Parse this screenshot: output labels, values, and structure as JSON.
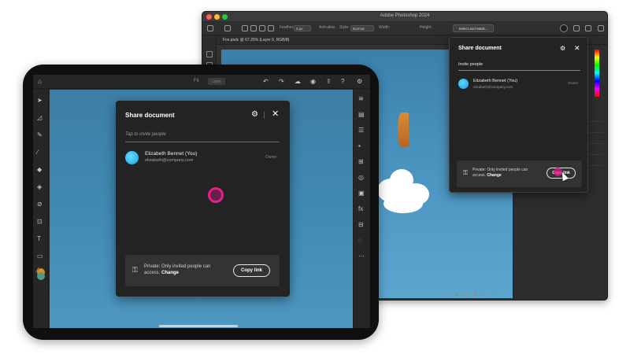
{
  "desktop": {
    "window_title": "Adobe Photoshop 2024",
    "options_bar": {
      "feather_label": "Feather:",
      "feather_value": "0 px",
      "antialias_label": "Anti-alias",
      "style_label": "Style:",
      "style_value": "Normal",
      "width_label": "Width:",
      "height_label": "Height:",
      "select_mask_label": "Select and Mask..."
    },
    "document_tab": "Fox.psdc @ 67.25% (Layer 0, RGB/8)",
    "share_popup": {
      "title": "Share document",
      "invite_placeholder": "Invite people",
      "user_name": "Elizabeth Bennet (You)",
      "user_email": "elizabeth@company.com",
      "user_role": "Owner",
      "private_text": "Private: Only invited people can access.",
      "change_label": "Change",
      "copy_link_label": "Copy link"
    }
  },
  "ipad": {
    "topbar": {
      "fit_label": "Fit",
      "fit_box": "100%"
    },
    "share_popup": {
      "title": "Share document",
      "invite_placeholder": "Tap to invite people",
      "user_name": "Elizabeth Bennet (You)",
      "user_email": "elizabeth@company.com",
      "user_role": "Owner",
      "private_text": "Private: Only invited people can access.",
      "change_label": "Change",
      "copy_link_label": "Copy link"
    }
  },
  "colors": {
    "canvas_sky": "#4a93bf",
    "popup_bg": "#232323",
    "tap_highlight": "#e81d8c",
    "avatar": "#1aa3dd"
  },
  "icons": {
    "home": "home-icon",
    "gear": "gear-icon",
    "close": "close-icon",
    "lock_people": "people-lock-icon",
    "cursor": "cursor-icon"
  }
}
